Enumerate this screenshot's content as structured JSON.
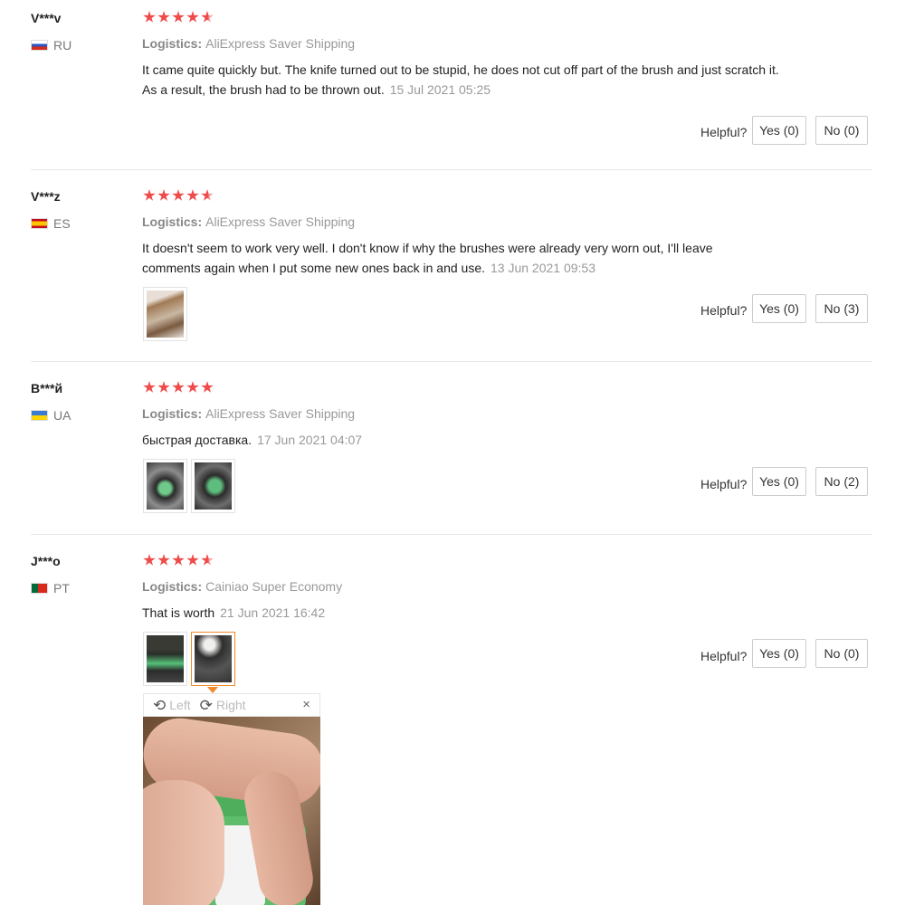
{
  "labels": {
    "logistics": "Logistics:",
    "helpful": "Helpful?"
  },
  "reviews": [
    {
      "user": "V***v",
      "country": "RU",
      "flag_colors": [
        "#ffffff",
        "#2a55c6",
        "#d52b1e"
      ],
      "rating": 5,
      "logistics": "AliExpress Saver Shipping",
      "comment": "It came quite quickly but. The knife turned out to be stupid, he does not cut off part of the brush and just scratch it. As a result, the brush had to be thrown out.",
      "date": "15 Jul 2021 05:25",
      "yes": "Yes (0)",
      "no": "No (0)"
    },
    {
      "user": "V***z",
      "country": "ES",
      "flag_colors": [
        "#c60b1e",
        "#ffc400"
      ],
      "rating": 5,
      "logistics": "AliExpress Saver Shipping",
      "comment": "It doesn't seem to work very well. I don't know if why the brushes were already very worn out, I'll leave comments again when I put some new ones back in and use.",
      "date": "13 Jun 2021 09:53",
      "yes": "Yes (0)",
      "no": "No (3)"
    },
    {
      "user": "B***й",
      "country": "UA",
      "flag_colors": [
        "#3a7bd5",
        "#ffd500"
      ],
      "rating": 5,
      "logistics": "AliExpress Saver Shipping",
      "comment": "быстрая доставка.",
      "date": "17 Jun 2021 04:07",
      "yes": "Yes (0)",
      "no": "No (2)"
    },
    {
      "user": "J***o",
      "country": "PT",
      "flag_colors": [
        "#046a38",
        "#da291c"
      ],
      "rating": 5,
      "logistics": "Cainiao Super Economy",
      "comment": "That is worth",
      "date": "21 Jun 2021 16:42",
      "yes": "Yes (0)",
      "no": "No (0)"
    }
  ],
  "viewer": {
    "rotate_left": "Left",
    "rotate_right": "Right",
    "close": "×"
  },
  "colors": {
    "star": "#f04b4b",
    "active_thumb_border": "#f08a2b"
  }
}
